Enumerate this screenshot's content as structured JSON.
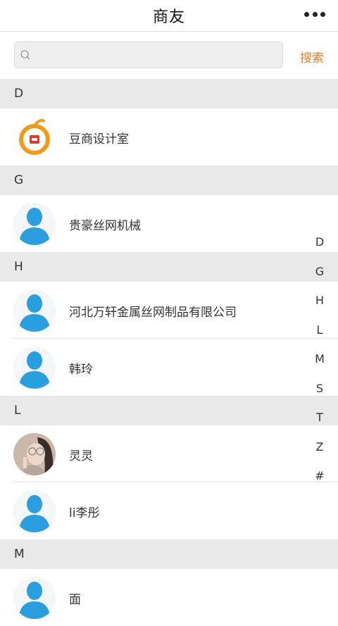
{
  "header": {
    "title": "商友",
    "more_icon": "more-horizontal-icon"
  },
  "search": {
    "placeholder": "",
    "button_label": "搜索",
    "icon": "search-icon"
  },
  "sections": [
    {
      "letter": "D",
      "contacts": [
        {
          "name": "豆商设计室",
          "avatar": "brand-logo"
        }
      ]
    },
    {
      "letter": "G",
      "contacts": [
        {
          "name": "贵豪丝网机械",
          "avatar": "default-person"
        }
      ]
    },
    {
      "letter": "H",
      "contacts": [
        {
          "name": "河北万轩金属丝网制品有限公司",
          "avatar": "default-person"
        },
        {
          "name": "韩玲",
          "avatar": "default-person"
        }
      ]
    },
    {
      "letter": "L",
      "contacts": [
        {
          "name": "灵灵",
          "avatar": "photo"
        },
        {
          "name": "li李彤",
          "avatar": "default-person"
        }
      ]
    },
    {
      "letter": "M",
      "contacts": [
        {
          "name": "面",
          "avatar": "default-person"
        }
      ]
    }
  ],
  "index_letters": [
    "D",
    "G",
    "H",
    "L",
    "M",
    "S",
    "T",
    "Z",
    "#"
  ],
  "colors": {
    "accent": "#e07f1f",
    "avatar_blue": "#2a9fe0",
    "section_bg": "#e9e9e9"
  }
}
